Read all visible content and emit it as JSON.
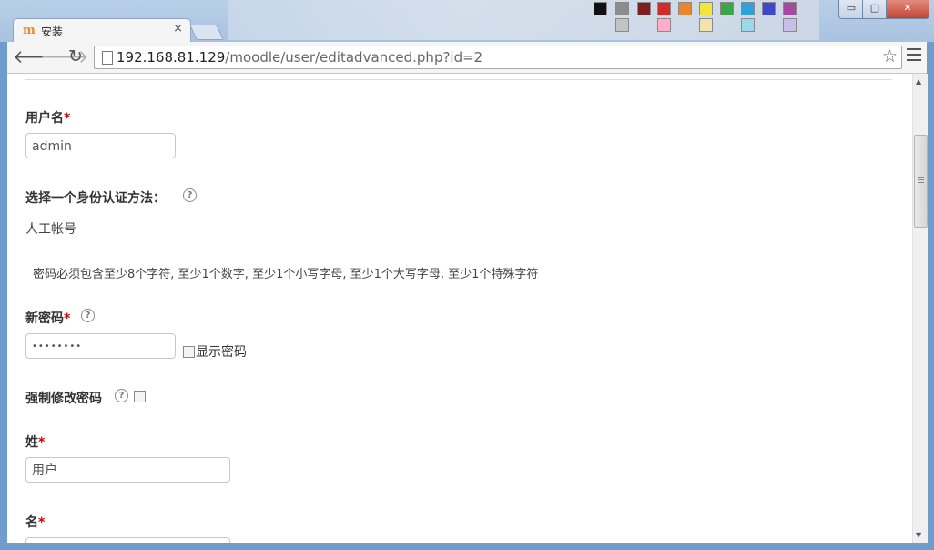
{
  "window": {
    "min_label": "▭",
    "max_label": "□",
    "close_label": "✕"
  },
  "tab": {
    "favicon": "m",
    "title": "安装",
    "close": "×"
  },
  "toolbar": {
    "url_host": "192.168.81.129",
    "url_path": "/moodle/user/editadvanced.php?id=2"
  },
  "form": {
    "username": {
      "label": "用户名",
      "required": "*",
      "value": "admin"
    },
    "auth": {
      "label": "选择一个身份认证方法：",
      "value": "人工帐号"
    },
    "password_note": "密码必须包含至少8个字符, 至少1个数字, 至少1个小写字母, 至少1个大写字母, 至少1个特殊字符",
    "new_password": {
      "label": "新密码",
      "required": "*",
      "value": "••••••••",
      "show_label": "显示密码"
    },
    "force_change": {
      "label": "强制修改密码"
    },
    "lastname": {
      "label": "姓",
      "required": "*",
      "value": "用户"
    },
    "firstname": {
      "label": "名",
      "required": "*"
    }
  },
  "icons": {
    "back": "back-arrow-icon",
    "forward": "forward-arrow-icon",
    "reload": "reload-icon",
    "star": "star-icon",
    "menu": "hamburger-menu-icon",
    "help": "question-mark-icon",
    "page": "page-icon"
  }
}
